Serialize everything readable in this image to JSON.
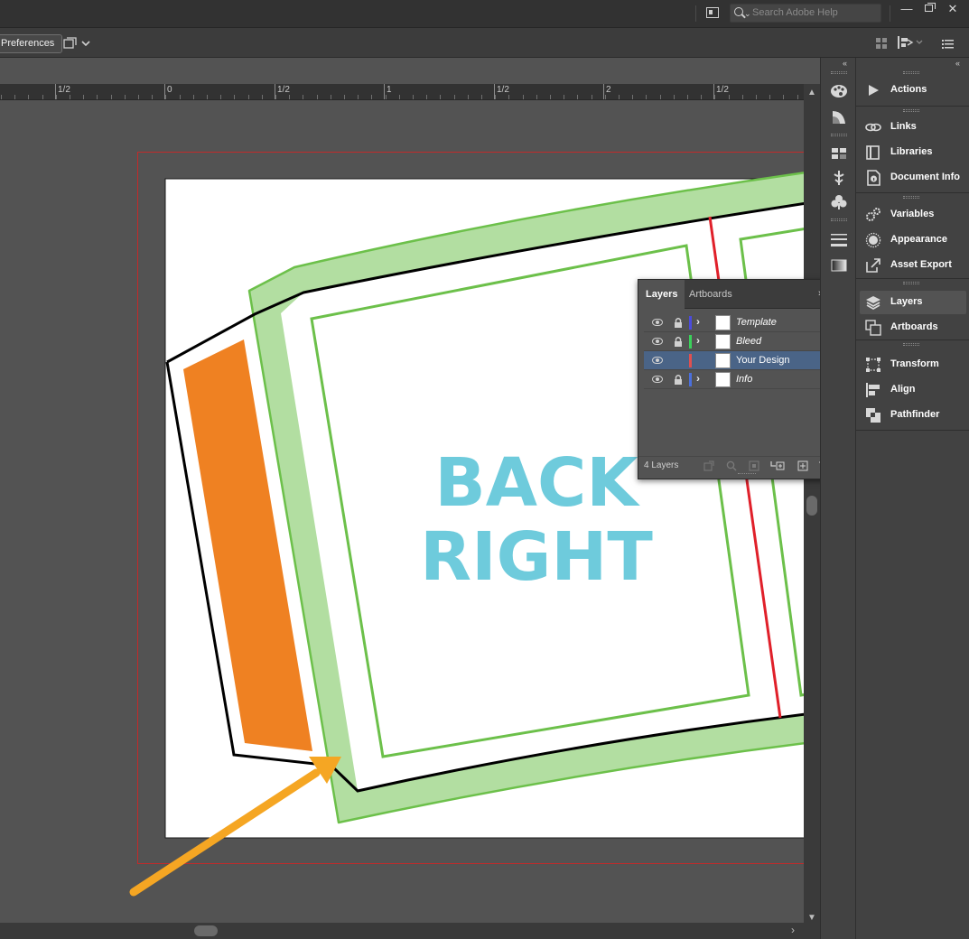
{
  "topbar": {
    "search_placeholder": "Search Adobe Help"
  },
  "controlbar": {
    "preferences_label": "Preferences"
  },
  "ruler": {
    "labels": [
      "1/2",
      "0",
      "1/2",
      "1",
      "1/2",
      "2",
      "1/2"
    ]
  },
  "artboard": {
    "line1": "BACK",
    "line2": "RIGHT",
    "text_color": "#6ecbdc",
    "accent_orange": "#ef8122",
    "bleed_green": "#6cc04a",
    "bleed_fill": "#b2dea1",
    "trim_red": "#e0202a",
    "arrow_color": "#f5a623"
  },
  "dock": {
    "items": [
      "Actions",
      "Links",
      "Libraries",
      "Document Info",
      "Variables",
      "Appearance",
      "Asset Export",
      "Layers",
      "Artboards",
      "Transform",
      "Align",
      "Pathfinder"
    ]
  },
  "layers_panel": {
    "tabs": [
      "Layers",
      "Artboards"
    ],
    "layers": [
      {
        "name": "Template",
        "color": "#4b4bdc",
        "italic": true,
        "locked": true,
        "selected": false
      },
      {
        "name": "Bleed",
        "color": "#3ad15a",
        "italic": true,
        "locked": true,
        "selected": false
      },
      {
        "name": "Your Design",
        "color": "#e05050",
        "italic": false,
        "locked": false,
        "selected": true
      },
      {
        "name": "Info",
        "color": "#4b6fdc",
        "italic": true,
        "locked": true,
        "selected": false
      }
    ],
    "count_label": "4 Layers"
  }
}
